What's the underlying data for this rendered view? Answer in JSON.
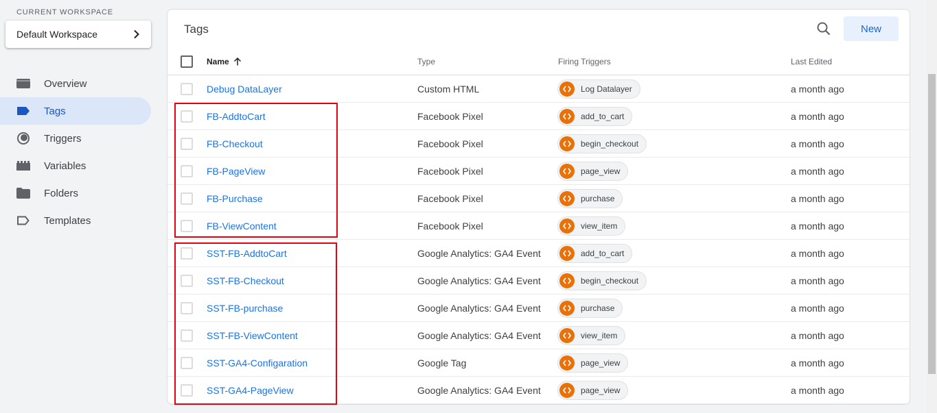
{
  "workspace": {
    "label": "CURRENT WORKSPACE",
    "name": "Default Workspace"
  },
  "nav": [
    {
      "label": "Overview",
      "icon": "overview-icon",
      "active": false
    },
    {
      "label": "Tags",
      "icon": "tag-icon",
      "active": true
    },
    {
      "label": "Triggers",
      "icon": "trigger-icon",
      "active": false
    },
    {
      "label": "Variables",
      "icon": "variables-icon",
      "active": false
    },
    {
      "label": "Folders",
      "icon": "folder-icon",
      "active": false
    },
    {
      "label": "Templates",
      "icon": "template-icon",
      "active": false
    }
  ],
  "tags_panel": {
    "title": "Tags",
    "new_label": "New",
    "columns": {
      "name": "Name",
      "type": "Type",
      "triggers": "Firing Triggers",
      "edited": "Last Edited"
    },
    "rows": [
      {
        "name": "Debug DataLayer",
        "type": "Custom HTML",
        "trigger": "Log Datalayer",
        "edited": "a month ago"
      },
      {
        "name": "FB-AddtoCart",
        "type": "Facebook Pixel",
        "trigger": "add_to_cart",
        "edited": "a month ago"
      },
      {
        "name": "FB-Checkout",
        "type": "Facebook Pixel",
        "trigger": "begin_checkout",
        "edited": "a month ago"
      },
      {
        "name": "FB-PageView",
        "type": "Facebook Pixel",
        "trigger": "page_view",
        "edited": "a month ago"
      },
      {
        "name": "FB-Purchase",
        "type": "Facebook Pixel",
        "trigger": "purchase",
        "edited": "a month ago"
      },
      {
        "name": "FB-ViewContent",
        "type": "Facebook Pixel",
        "trigger": "view_item",
        "edited": "a month ago"
      },
      {
        "name": "SST-FB-AddtoCart",
        "type": "Google Analytics: GA4 Event",
        "trigger": "add_to_cart",
        "edited": "a month ago"
      },
      {
        "name": "SST-FB-Checkout",
        "type": "Google Analytics: GA4 Event",
        "trigger": "begin_checkout",
        "edited": "a month ago"
      },
      {
        "name": "SST-FB-purchase",
        "type": "Google Analytics: GA4 Event",
        "trigger": "purchase",
        "edited": "a month ago"
      },
      {
        "name": "SST-FB-ViewContent",
        "type": "Google Analytics: GA4 Event",
        "trigger": "view_item",
        "edited": "a month ago"
      },
      {
        "name": "SST-GA4-Configaration",
        "type": "Google Tag",
        "trigger": "page_view",
        "edited": "a month ago"
      },
      {
        "name": "SST-GA4-PageView",
        "type": "Google Analytics: GA4 Event",
        "trigger": "page_view",
        "edited": "a month ago"
      }
    ]
  },
  "colors": {
    "accent": "#1a73e8",
    "trigger_icon": "#e8710a",
    "active_nav_bg": "#dbe6f9",
    "highlight": "#e3000f"
  }
}
